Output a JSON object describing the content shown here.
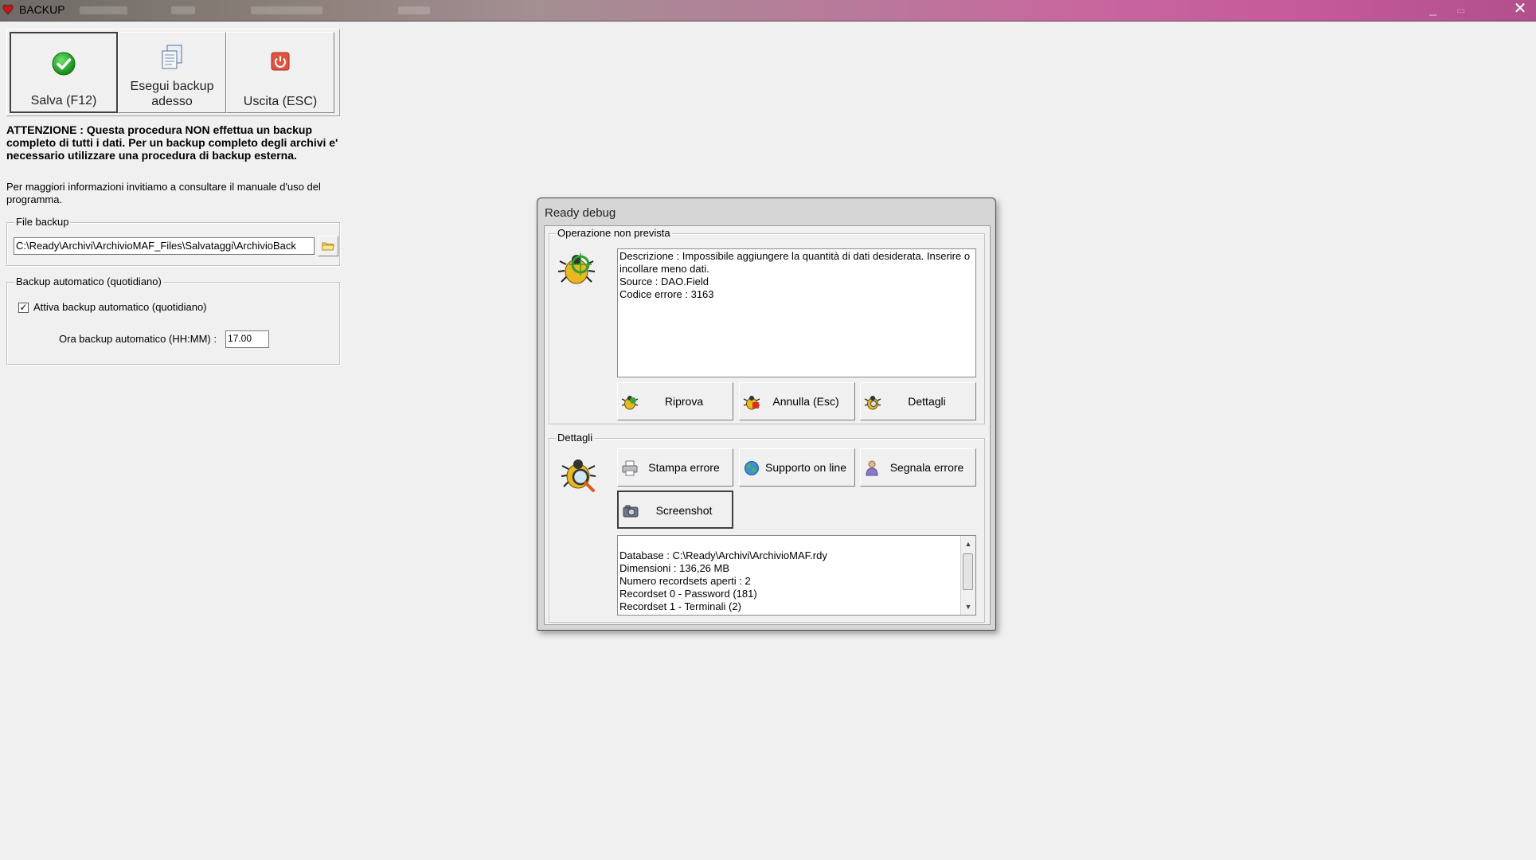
{
  "window": {
    "title": "BACKUP",
    "close_glyph": "✕"
  },
  "toolbar": {
    "save_label": "Salva (F12)",
    "run_backup_label": "Esegui backup adesso",
    "exit_label": "Uscita (ESC)"
  },
  "notice": {
    "warning": "ATTENZIONE : Questa procedura NON effettua un backup completo di tutti i dati. Per un backup completo degli archivi e' necessario utilizzare una procedura di backup esterna.",
    "info": "Per maggiori informazioni invitiamo a consultare il manuale d'uso del programma."
  },
  "file_backup": {
    "legend": "File backup",
    "path": "C:\\Ready\\Archivi\\ArchivioMAF_Files\\Salvataggi\\ArchivioBack"
  },
  "auto_backup": {
    "legend": "Backup automatico (quotidiano)",
    "checkbox_label": "Attiva backup automatico (quotidiano)",
    "checked": true,
    "check_glyph": "✓",
    "time_label": "Ora backup automatico (HH:MM) :",
    "time_value": "17.00"
  },
  "debug_dialog": {
    "title": "Ready debug",
    "error_group": {
      "legend": "Operazione non prevista",
      "lines": [
        "Descrizione : Impossibile aggiungere la quantità di dati desiderata. Inserire o incollare meno dati.",
        "Source : DAO.Field",
        "Codice errore : 3163"
      ],
      "buttons": {
        "retry": "Riprova",
        "cancel": "Annulla (Esc)",
        "details": "Dettagli"
      }
    },
    "details_group": {
      "legend": "Dettagli",
      "buttons": {
        "print_error": "Stampa errore",
        "online_support": "Supporto on line",
        "report_error": "Segnala errore",
        "screenshot": "Screenshot"
      },
      "log_lines": [
        "Database : C:\\Ready\\Archivi\\ArchivioMAF.rdy",
        "Dimensioni : 136,26 MB",
        "Numero recordsets aperti : 2",
        "Recordset 0 - Password (181)",
        "Recordset 1 - Terminali (2)"
      ]
    }
  },
  "icons": {
    "save": "checkmark-icon",
    "run_backup": "document-copy-icon",
    "exit": "power-icon",
    "browse": "folder-icon",
    "bug": "bug-icon",
    "print": "printer-icon",
    "support": "globe-icon",
    "report": "person-icon",
    "camera": "camera-icon"
  },
  "colors": {
    "check_green": "#1ea21e",
    "exit_red": "#d9483b",
    "titlebar_pink": "#c55a9a"
  }
}
